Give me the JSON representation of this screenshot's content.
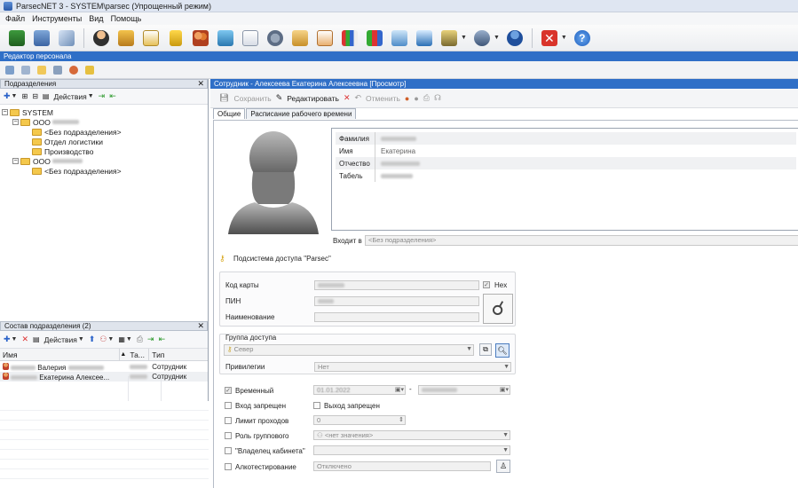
{
  "window": {
    "title": "ParsecNET 3 - SYSTEM\\parsec (Упрощенный режим)"
  },
  "menu": [
    "Файл",
    "Инструменты",
    "Вид",
    "Помощь"
  ],
  "toolbar_icons": [
    "workstation-icon",
    "building-icon",
    "document-icon",
    "person-icon",
    "house-icon",
    "calendar-icon",
    "lock-icon",
    "users-icon",
    "monitor-icon",
    "schedule-icon",
    "settings-icon",
    "card-icon",
    "report-icon",
    "chart-icon",
    "chart2-icon",
    "id-card-icon",
    "id-card2-icon",
    "photo-icon",
    "camera-icon",
    "user-blue-icon",
    "close-red-icon",
    "help-icon"
  ],
  "editor_strip": "Редактор персонала",
  "left": {
    "tree_header": "Подразделения",
    "tree_toolbar": {
      "actions": "Действия"
    },
    "tree": [
      {
        "label": "SYSTEM",
        "level": 0
      },
      {
        "label": "ООО",
        "level": 1
      },
      {
        "label": "<Без подразделения>",
        "level": 2
      },
      {
        "label": "Отдел логистики",
        "level": 2
      },
      {
        "label": "Производство",
        "level": 2
      },
      {
        "label": "ООО",
        "level": 1
      },
      {
        "label": "<Без подразделения>",
        "level": 2
      }
    ],
    "list_header": "Состав подразделения (2)",
    "list_toolbar": {
      "actions": "Действия"
    },
    "columns": [
      "Имя",
      "Та...",
      "Тип"
    ],
    "rows": [
      {
        "name": "Валерия",
        "type": "Сотрудник"
      },
      {
        "name": "Екатерина Алексее...",
        "type": "Сотрудник"
      }
    ]
  },
  "right": {
    "header": "Сотрудник - Алексеева Екатерина Алексеевна [Просмотр]",
    "toolbar": {
      "save": "Сохранить",
      "edit": "Редактировать",
      "cancel": "Отменить"
    },
    "tabs": [
      "Общие",
      "Расписание рабочего времени"
    ],
    "fields": [
      {
        "label": "Фамилия",
        "value": ""
      },
      {
        "label": "Имя",
        "value": "Екатерина"
      },
      {
        "label": "Отчество",
        "value": ""
      },
      {
        "label": "Табель",
        "value": ""
      }
    ],
    "belongs_label": "Входит в",
    "belongs_value": "<Без подразделения>",
    "subsystem": "Подсистема доступа \"Parsec\"",
    "card_code_label": "Код карты",
    "hex_label": "Hex",
    "pin_label": "ПИН",
    "name_label": "Наименование",
    "access_group_label": "Группа доступа",
    "access_group_value": "Север",
    "privileges_label": "Привилегии",
    "privileges_value": "Нет",
    "temporary_label": "Временный",
    "temp_from": "01.01.2022",
    "entry_forbidden": "Вход запрещен",
    "exit_forbidden": "Выход запрещен",
    "pass_limit_label": "Лимит проходов",
    "pass_limit_value": "0",
    "group_role_label": "Роль группового",
    "group_role_value": "<нет значения>",
    "cabinet_owner_label": "\"Владелец кабинета\"",
    "alcotest_label": "Алкотестирование",
    "alcotest_value": "Отключено"
  }
}
